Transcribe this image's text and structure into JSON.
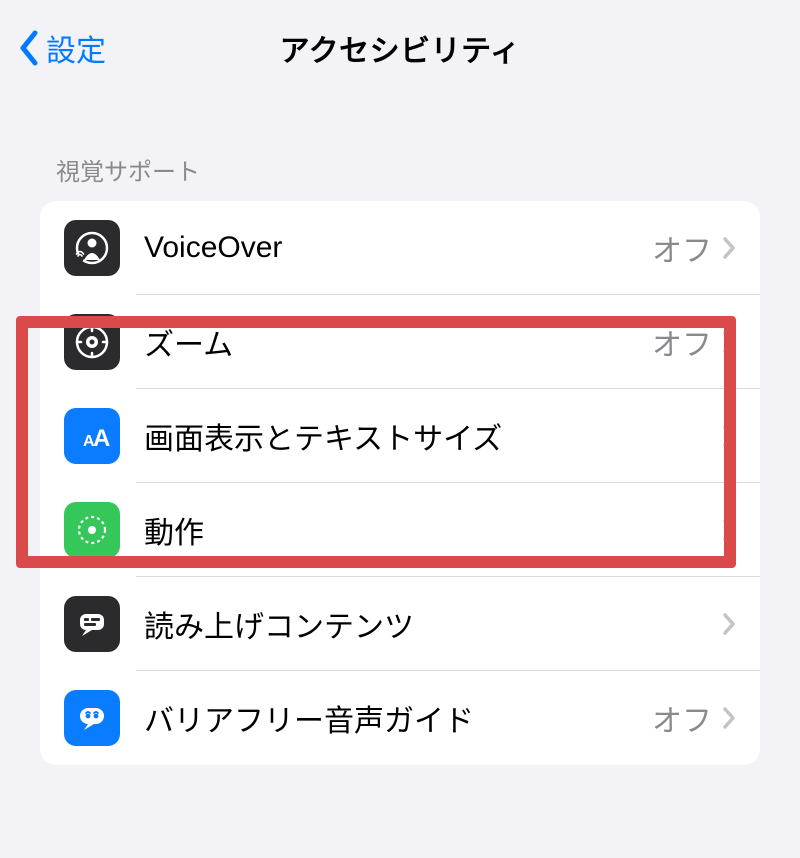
{
  "navbar": {
    "back_label": "設定",
    "title": "アクセシビリティ"
  },
  "section": {
    "header": "視覚サポート",
    "items": [
      {
        "label": "VoiceOver",
        "value": "オフ"
      },
      {
        "label": "ズーム",
        "value": "オフ"
      },
      {
        "label": "画面表示とテキストサイズ",
        "value": ""
      },
      {
        "label": "動作",
        "value": ""
      },
      {
        "label": "読み上げコンテンツ",
        "value": ""
      },
      {
        "label": "バリアフリー音声ガイド",
        "value": "オフ"
      }
    ]
  }
}
